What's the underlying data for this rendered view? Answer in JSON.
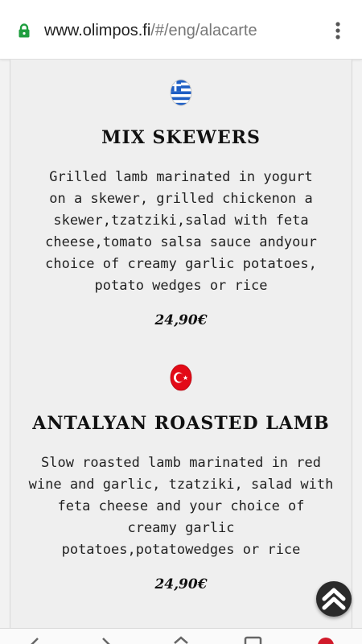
{
  "browser": {
    "url_domain": "www.olimpos.fi",
    "url_path": "/#/eng/alacarte",
    "lock_icon": "lock-icon",
    "menu_icon": "more-vert-icon"
  },
  "dishes": [
    {
      "flag": "greece-flag-icon",
      "title": "MIX SKEWERS",
      "description_lines": [
        "Grilled lamb marinated in yogurt",
        "on a skewer, grilled chickenon a",
        "skewer,tzatziki,salad with feta",
        "cheese,tomato salsa sauce andyour",
        "choice of creamy garlic potatoes,",
        "potato wedges or rice"
      ],
      "price": "24,90€"
    },
    {
      "flag": "turkey-flag-icon",
      "title": "ANTALYAN ROASTED LAMB",
      "description_lines": [
        "Slow roasted lamb marinated in red",
        "wine and garlic, tzatziki, salad with",
        "feta cheese and your choice of",
        "creamy garlic",
        "potatoes,potatowedges or rice"
      ],
      "price": "24,90€"
    }
  ],
  "scroll_top": {
    "icon": "double-chevron-up-icon"
  },
  "bottom_nav": {
    "icons": [
      "back-icon",
      "forward-icon",
      "home-icon",
      "tabs-icon",
      "profile-icon"
    ]
  },
  "colors": {
    "background": "#efefef",
    "lock_green": "#1e9e3e",
    "greek_blue": "#1f5fc4",
    "turkish_red": "#e30a17"
  }
}
